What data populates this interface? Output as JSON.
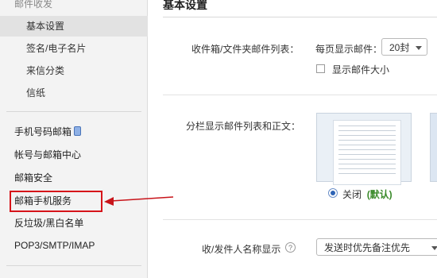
{
  "sidebar": {
    "group_label": "邮件收发",
    "sub_items": [
      {
        "label": "基本设置"
      },
      {
        "label": "签名/电子名片"
      },
      {
        "label": "来信分类"
      },
      {
        "label": "信纸"
      }
    ],
    "items": [
      {
        "label": "手机号码邮箱",
        "icon": "phone-icon"
      },
      {
        "label": "帐号与邮箱中心"
      },
      {
        "label": "邮箱安全"
      },
      {
        "label": "邮箱手机服务"
      },
      {
        "label": "反垃圾/黑白名单"
      },
      {
        "label": "POP3/SMTP/IMAP"
      }
    ]
  },
  "main": {
    "title": "基本设置",
    "inbox_list": {
      "label": "收件箱/文件夹邮件列表：",
      "per_page_label": "每页显示邮件：",
      "per_page_value": "20封",
      "show_size_label": "显示邮件大小"
    },
    "split_view": {
      "label": "分栏显示邮件列表和正文：",
      "off_label": "关闭",
      "default_tag": "(默认)"
    },
    "sender_name": {
      "label": "收/发件人名称显示",
      "help_icon": "?",
      "value": "发送时优先备注优先"
    }
  },
  "colors": {
    "highlight": "#d6141a",
    "arrow": "#c8141a",
    "default_tag": "#3a8a2a",
    "radio": "#2d63b5"
  }
}
